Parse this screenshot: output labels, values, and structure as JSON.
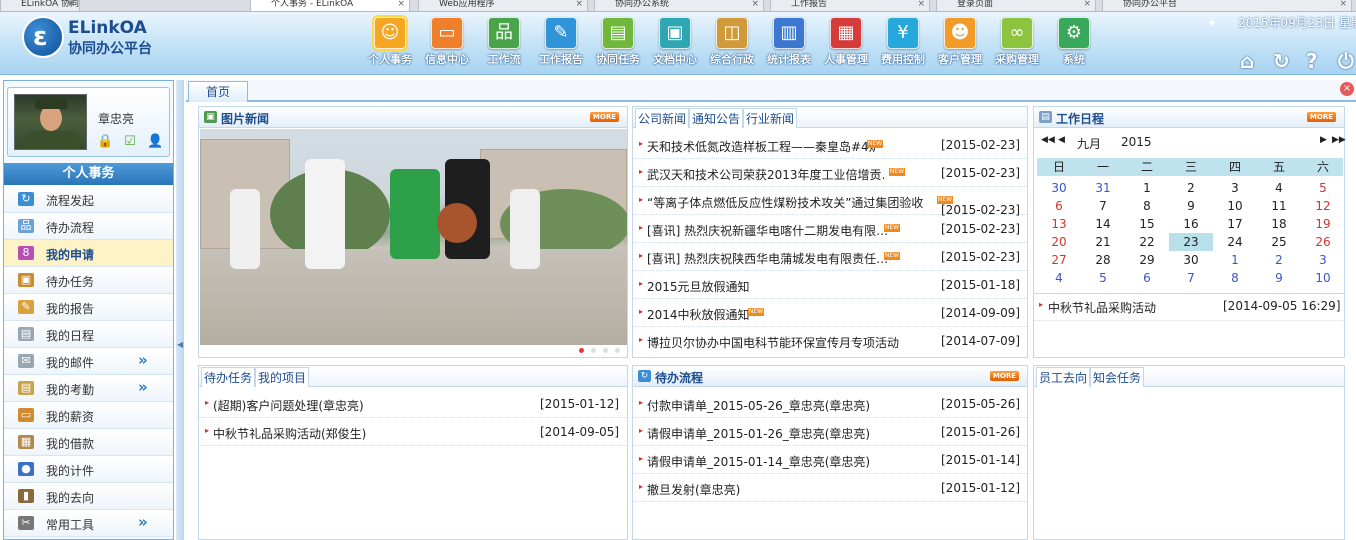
{
  "browser_tabs": [
    {
      "label": "ELinkOA 协同办公平台"
    },
    {
      "label": "个人事务 - ELinkOA"
    },
    {
      "label": "Web应用程序"
    },
    {
      "label": "协同办公系统"
    },
    {
      "label": "工作报告"
    },
    {
      "label": "登录页面"
    },
    {
      "label": "协同办公平台"
    }
  ],
  "header": {
    "logo_title": "ELinkOA",
    "logo_subtitle": "协同办公平台",
    "date_text": "2015年09月23日 星期",
    "nav": [
      {
        "label": "个人事务",
        "icon": "person-icon",
        "color": "#f5a623"
      },
      {
        "label": "信息中心",
        "icon": "chat-icon",
        "color": "#f07f2c"
      },
      {
        "label": "工作流",
        "icon": "flow-icon",
        "color": "#4aa44a"
      },
      {
        "label": "工作报告",
        "icon": "report-icon",
        "color": "#2f95d8"
      },
      {
        "label": "协同任务",
        "icon": "task-icon",
        "color": "#6fb83c"
      },
      {
        "label": "文档中心",
        "icon": "folder-icon",
        "color": "#2fa7b3"
      },
      {
        "label": "综合行政",
        "icon": "admin-icon",
        "color": "#d09a3a"
      },
      {
        "label": "统计报表",
        "icon": "chart-icon",
        "color": "#3c78d0"
      },
      {
        "label": "人事管理",
        "icon": "hr-icon",
        "color": "#d53b3b"
      },
      {
        "label": "费用控制",
        "icon": "yen-icon",
        "color": "#26a8dc"
      },
      {
        "label": "客户管理",
        "icon": "customer-icon",
        "color": "#f29b28"
      },
      {
        "label": "采购管理",
        "icon": "purchase-icon",
        "color": "#8cc43f"
      },
      {
        "label": "系统",
        "icon": "gear-icon",
        "color": "#3aa85a"
      }
    ]
  },
  "profile": {
    "name": "章忠亮"
  },
  "sidebar": {
    "title": "个人事务",
    "items": [
      {
        "label": "流程发起",
        "icon": "refresh-icon",
        "color": "#3b8ed6"
      },
      {
        "label": "待办流程",
        "icon": "flow-icon",
        "color": "#6aa2d8"
      },
      {
        "label": "我的申请",
        "icon": "apply-icon",
        "color": "#b64fb6"
      },
      {
        "label": "待办任务",
        "icon": "task-icon",
        "color": "#c98b2c"
      },
      {
        "label": "我的报告",
        "icon": "report-icon",
        "color": "#d9a23a"
      },
      {
        "label": "我的日程",
        "icon": "calendar-icon",
        "color": "#9aa6b4"
      },
      {
        "label": "我的邮件",
        "icon": "mail-icon",
        "color": "#9aa6b4",
        "more": "»"
      },
      {
        "label": "我的考勤",
        "icon": "attendance-icon",
        "color": "#caa24a",
        "more": "»"
      },
      {
        "label": "我的薪资",
        "icon": "salary-icon",
        "color": "#d28a2f"
      },
      {
        "label": "我的借款",
        "icon": "loan-icon",
        "color": "#b4884a"
      },
      {
        "label": "我的计件",
        "icon": "count-icon",
        "color": "#3b6fc8"
      },
      {
        "label": "我的去向",
        "icon": "book-icon",
        "color": "#8a6a3a"
      },
      {
        "label": "常用工具",
        "icon": "tools-icon",
        "color": "#777777",
        "more": "»"
      }
    ]
  },
  "content": {
    "home_tab": "首页",
    "photo_news": {
      "title": "图片新闻",
      "more": "MORE"
    },
    "company_news": {
      "tabs": [
        "公司新闻",
        "通知公告",
        "行业新闻"
      ],
      "items": [
        {
          "title": "天和技术低氮改造样板工程——秦皇岛#4炉",
          "new": true,
          "date": "[2015-02-23]"
        },
        {
          "title": "武汉天和技术公司荣获2013年度工业倍增贡…",
          "new": true,
          "date": "[2015-02-23]"
        },
        {
          "title": "“等离子体点燃低反应性煤粉技术攻关”通过集团验收",
          "new": true,
          "date": "[2015-02-23]"
        },
        {
          "title": "[喜讯] 热烈庆祝新疆华电喀什二期发电有限…",
          "new": true,
          "date": "[2015-02-23]"
        },
        {
          "title": "[喜讯] 热烈庆祝陕西华电蒲城发电有限责任…",
          "new": true,
          "date": "[2015-02-23]"
        },
        {
          "title": "2015元旦放假通知",
          "new": false,
          "date": "[2015-01-18]"
        },
        {
          "title": "2014中秋放假通知",
          "new": true,
          "date": "[2014-09-09]"
        },
        {
          "title": "博拉贝尔协办中国电科节能环保宣传月专项活动",
          "new": false,
          "date": "[2014-07-09]"
        }
      ]
    },
    "schedule": {
      "title": "工作日程",
      "more": "MORE",
      "nav_first": "◀◀",
      "nav_prev": "◀",
      "month": "九月",
      "year": "2015",
      "nav_next": "▶",
      "nav_last": "▶▶",
      "weekdays": [
        "日",
        "一",
        "二",
        "三",
        "四",
        "五",
        "六"
      ],
      "weeks": [
        [
          "30",
          "31",
          "1",
          "2",
          "3",
          "4",
          "5"
        ],
        [
          "6",
          "7",
          "8",
          "9",
          "10",
          "11",
          "12"
        ],
        [
          "13",
          "14",
          "15",
          "16",
          "17",
          "18",
          "19"
        ],
        [
          "20",
          "21",
          "22",
          "23",
          "24",
          "25",
          "26"
        ],
        [
          "27",
          "28",
          "29",
          "30",
          "1",
          "2",
          "3"
        ],
        [
          "4",
          "5",
          "6",
          "7",
          "8",
          "9",
          "10"
        ]
      ],
      "today": "23",
      "events": [
        {
          "title": "中秋节礼品采购活动",
          "date": "[2014-09-05 16:29]"
        }
      ]
    },
    "pending_tasks": {
      "tabs": [
        "待办任务",
        "我的项目"
      ],
      "items": [
        {
          "title": "(超期)客户问题处理(章忠亮)",
          "date": "[2015-01-12]"
        },
        {
          "title": "中秋节礼品采购活动(郑俊生)",
          "date": "[2014-09-05]"
        }
      ]
    },
    "pending_flow": {
      "title": "待办流程",
      "more": "MORE",
      "items": [
        {
          "title": "付款申请单_2015-05-26_章忠亮(章忠亮)",
          "date": "[2015-05-26]"
        },
        {
          "title": "请假申请单_2015-01-26_章忠亮(章忠亮)",
          "date": "[2015-01-26]"
        },
        {
          "title": "请假申请单_2015-01-14_章忠亮(章忠亮)",
          "date": "[2015-01-14]"
        },
        {
          "title": "撤旦发射(章忠亮)",
          "date": "[2015-01-12]"
        }
      ]
    },
    "staff": {
      "tabs": [
        "员工去向",
        "知会任务"
      ]
    }
  }
}
